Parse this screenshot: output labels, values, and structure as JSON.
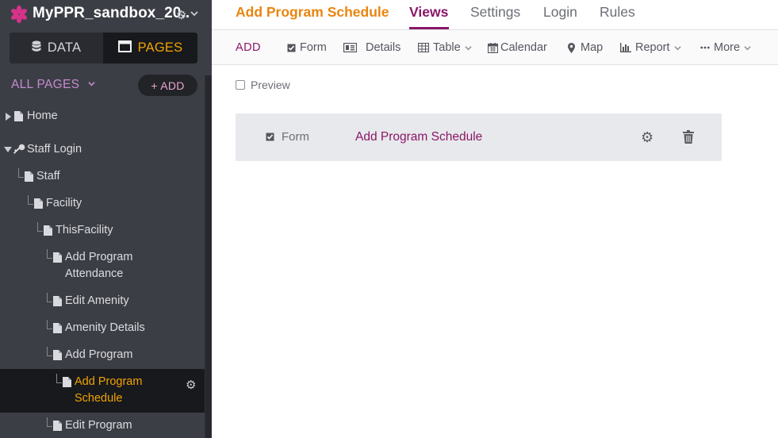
{
  "app": {
    "name": "MyPPR_sandbox_20..",
    "logo_icon": "asterisk-logo",
    "brand_color": "#d6338a"
  },
  "modes": {
    "data_label": "DATA",
    "pages_label": "PAGES",
    "active": "PAGES",
    "active_color": "#f0a300"
  },
  "pages_nav": {
    "all_pages_label": "ALL PAGES",
    "add_label": "+ ADD",
    "items": [
      {
        "label": "Home"
      },
      {
        "label": "Staff Login"
      },
      {
        "label": "Staff"
      },
      {
        "label": "Facility"
      },
      {
        "label": "ThisFacility"
      },
      {
        "label": "Add Program",
        "label2": "Attendance"
      },
      {
        "label": "Edit Amenity"
      },
      {
        "label": "Amenity Details"
      },
      {
        "label": "Add Program"
      },
      {
        "label": "Add Program",
        "label2": "Schedule",
        "active": true
      },
      {
        "label": "Edit Program"
      }
    ]
  },
  "header": {
    "page_name": "Add Program Schedule",
    "tabs": [
      {
        "label": "Views",
        "active": true
      },
      {
        "label": "Settings"
      },
      {
        "label": "Login"
      },
      {
        "label": "Rules"
      }
    ],
    "accent_color": "#8a1768",
    "page_name_color": "#e9850f"
  },
  "view_toolbar": {
    "add_label": "ADD",
    "items": [
      {
        "label": "Form",
        "icon": "checkbox-icon"
      },
      {
        "label": "Details",
        "icon": "details-icon"
      },
      {
        "label": "Table",
        "icon": "table-icon"
      },
      {
        "label": "Calendar",
        "icon": "calendar-icon"
      },
      {
        "label": "Map",
        "icon": "map-pin-icon"
      },
      {
        "label": "Report",
        "icon": "bar-chart-icon"
      },
      {
        "label": "More",
        "icon": "ellipsis-icon"
      }
    ]
  },
  "preview": {
    "label": "Preview",
    "checked": false
  },
  "views": [
    {
      "type": "Form",
      "name": "Add Program Schedule"
    }
  ]
}
